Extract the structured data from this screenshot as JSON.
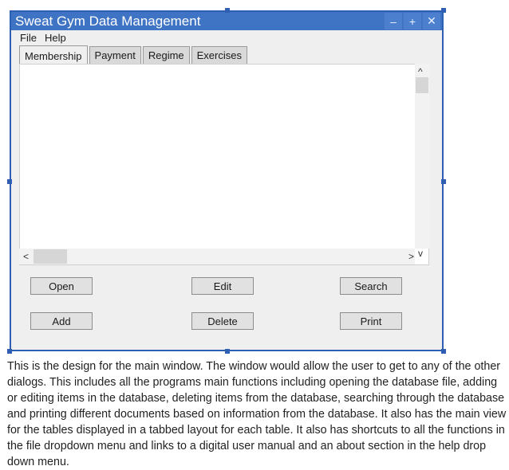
{
  "window": {
    "title": "Sweat Gym Data Management"
  },
  "window_controls": {
    "minimize": "–",
    "maximize": "+",
    "close": "✕"
  },
  "menu": [
    {
      "label": "File"
    },
    {
      "label": "Help"
    }
  ],
  "tabs": [
    {
      "label": "Membership",
      "active": true
    },
    {
      "label": "Payment"
    },
    {
      "label": "Regime"
    },
    {
      "label": "Exercises"
    }
  ],
  "scroll_icons": {
    "up": "^",
    "down": "v",
    "left": "<",
    "right": ">"
  },
  "buttons": {
    "open": "Open",
    "edit": "Edit",
    "search": "Search",
    "add": "Add",
    "delete": "Delete",
    "print": "Print"
  },
  "description": "This is the design for the main window. The window would allow the user to get to any of the other dialogs. This includes all the programs main functions including opening the database file, adding or editing items in the database, deleting items from the database, searching through the database and printing different documents based on information from the database. It also has the main view for the tables displayed in a tabbed layout for each table. It also has shortcuts to all the functions in the file dropdown menu and links to a digital user manual and an about section in the help drop down menu."
}
